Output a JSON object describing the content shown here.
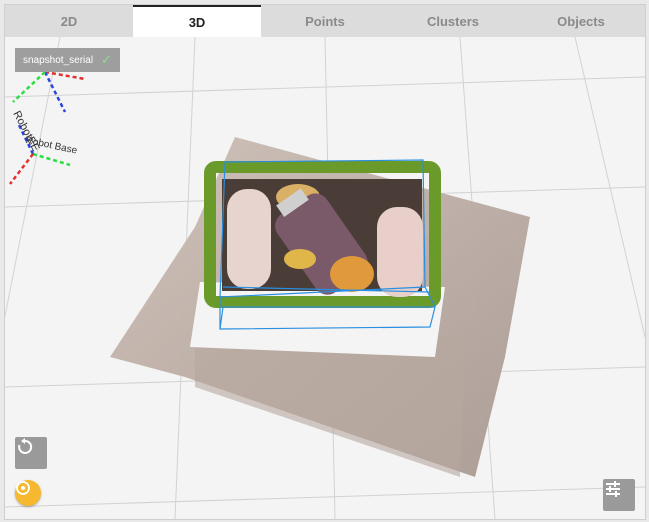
{
  "tabs": [
    {
      "label": "2D",
      "active": false
    },
    {
      "label": "3D",
      "active": true
    },
    {
      "label": "Points",
      "active": false
    },
    {
      "label": "Clusters",
      "active": false
    },
    {
      "label": "Objects",
      "active": false
    }
  ],
  "snapshot": {
    "label": "snapshot_serial",
    "status_icon": "check-icon"
  },
  "axes_labels": {
    "ee": "RobotEE",
    "base": "Robot Base"
  },
  "controls": {
    "reset_icon": "reset-view-icon",
    "settings_icon": "sliders-icon",
    "capture_icon": "camera-shutter-icon"
  },
  "colors": {
    "active_tab_bg": "#ffffff",
    "tab_bar_bg": "#dcdcdc",
    "box_outline": "#2a8fe0",
    "gripper_green": "#6a9a2a",
    "fab": "#f5b82e"
  }
}
